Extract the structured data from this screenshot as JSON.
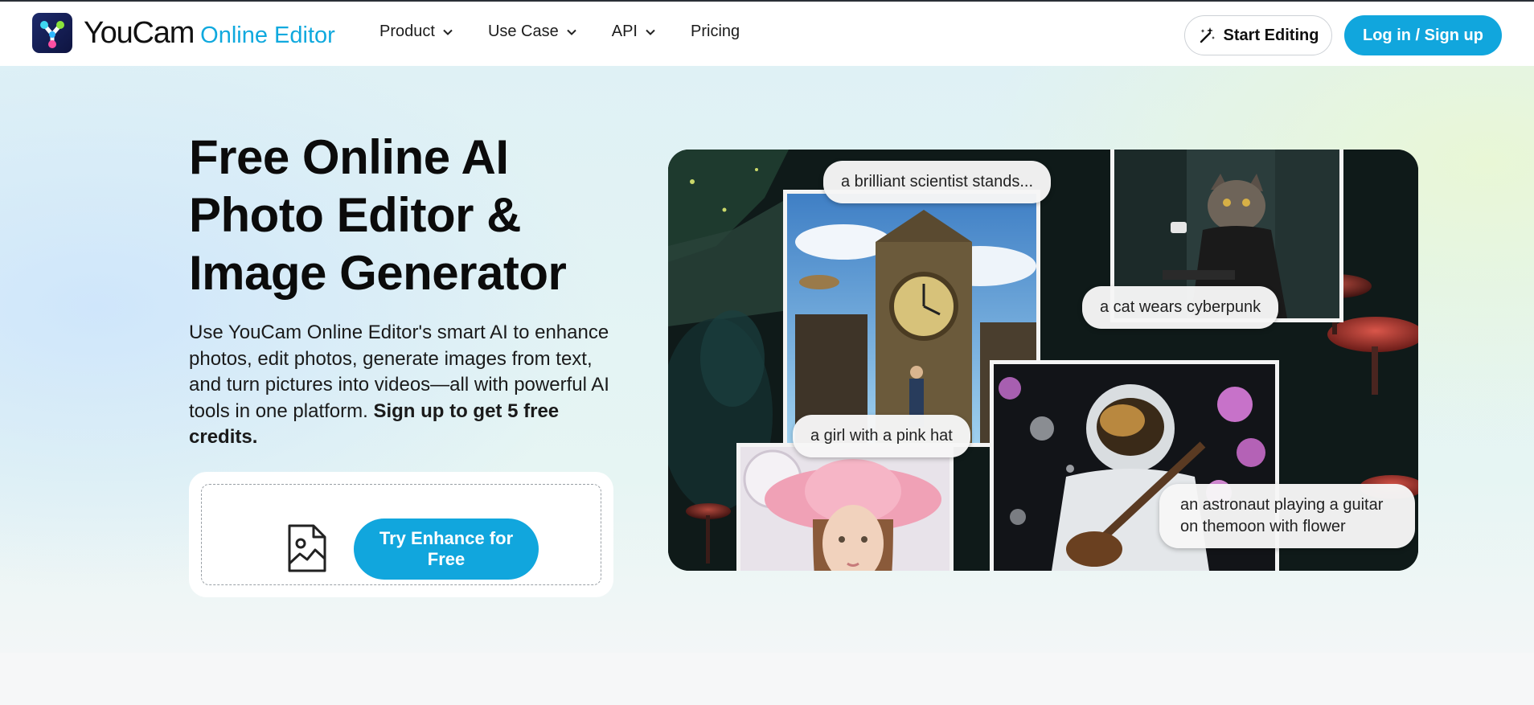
{
  "header": {
    "brand_name": "YouCam",
    "brand_suffix": "Online Editor",
    "nav": [
      {
        "label": "Product",
        "has_dropdown": true
      },
      {
        "label": "Use Case",
        "has_dropdown": true
      },
      {
        "label": "API",
        "has_dropdown": true
      },
      {
        "label": "Pricing",
        "has_dropdown": false
      }
    ],
    "start_editing_label": "Start Editing",
    "start_editing_icon": "magic-wand-icon",
    "login_label": "Log in / Sign up"
  },
  "hero": {
    "title": "Free Online AI Photo Editor & Image Generator",
    "description": "Use YouCam Online Editor's smart AI to enhance photos, edit photos, generate images from text, and turn pictures into videos—all with powerful AI tools in one platform. ",
    "description_bold": "Sign up to get 5 free credits.",
    "upload_icon": "image-file-icon",
    "cta_label": "Try Enhance for Free"
  },
  "collage": {
    "captions": [
      "a brilliant scientist stands...",
      "a cat wears cyberpunk",
      "a girl with a pink hat",
      "an astronaut playing a guitar on themoon with flower"
    ]
  },
  "colors": {
    "accent": "#11a6dd",
    "brand_suffix": "#10a9de",
    "text": "#111111"
  }
}
